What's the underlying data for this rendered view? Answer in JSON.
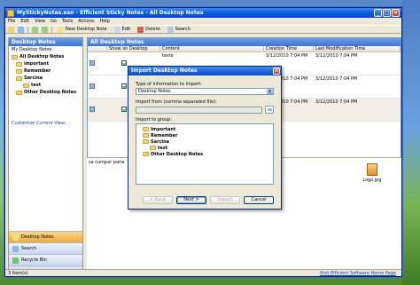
{
  "window": {
    "title": "MyStickyNotes.esn - Efficient Sticky Notes - All Desktop Notes"
  },
  "menu": [
    "File",
    "Edit",
    "View",
    "Go",
    "Tools",
    "Actions",
    "Help"
  ],
  "toolbar": {
    "new_label": "New Desktop Note",
    "edit_label": "Edit",
    "delete_label": "Delete",
    "search_label": "Search"
  },
  "left_pane": {
    "header": "Desktop Notes",
    "subheader": "My Desktop Notes",
    "root": "All Desktop Notes",
    "folders": [
      {
        "label": "important",
        "indent": 1
      },
      {
        "label": "Remember",
        "indent": 1
      },
      {
        "label": "Sarcina",
        "indent": 1
      },
      {
        "label": "test",
        "indent": 2
      },
      {
        "label": "Other Desktop Notes",
        "indent": 1
      }
    ],
    "customize": "Customize Current View...",
    "nav": [
      "Desktop Notes",
      "Search",
      "Recycle Bin"
    ]
  },
  "right_pane": {
    "header": "All Desktop Notes",
    "columns": [
      "",
      "Show on Desktop",
      "Content",
      "Creation Time",
      "Last Modification Time"
    ],
    "rows": [
      {
        "content": "teste",
        "created": "3/12/2010 7:04 PM",
        "modified": "3/12/2010 7:04 PM"
      },
      {
        "content": "",
        "created": "3/12/2010 7:04 PM",
        "modified": "3/12/2010 7:04 PM"
      },
      {
        "content": "",
        "created": "3/12/2010 7:04 PM",
        "modified": "3/12/2010 7:04 PM"
      }
    ],
    "preview_text": "sa cumpar pane",
    "attachment": "Logo.jpg"
  },
  "status": {
    "items": "3 Item(s)",
    "link": "Visit Efficient Software Home Page"
  },
  "dialog": {
    "title": "Import Desktop Notes",
    "type_label": "Type of information to import:",
    "type_value": "Desktop Notes",
    "file_label": "Import from (comma separated file):",
    "group_label": "Import to group:",
    "groups": [
      {
        "label": "Important",
        "indent": 1
      },
      {
        "label": "Remember",
        "indent": 1
      },
      {
        "label": "Sarcina",
        "indent": 1
      },
      {
        "label": "test",
        "indent": 2
      },
      {
        "label": "Other Desktop Notes",
        "indent": 1
      }
    ],
    "back": "< Back",
    "next": "Next >",
    "import": "Import",
    "cancel": "Cancel"
  }
}
